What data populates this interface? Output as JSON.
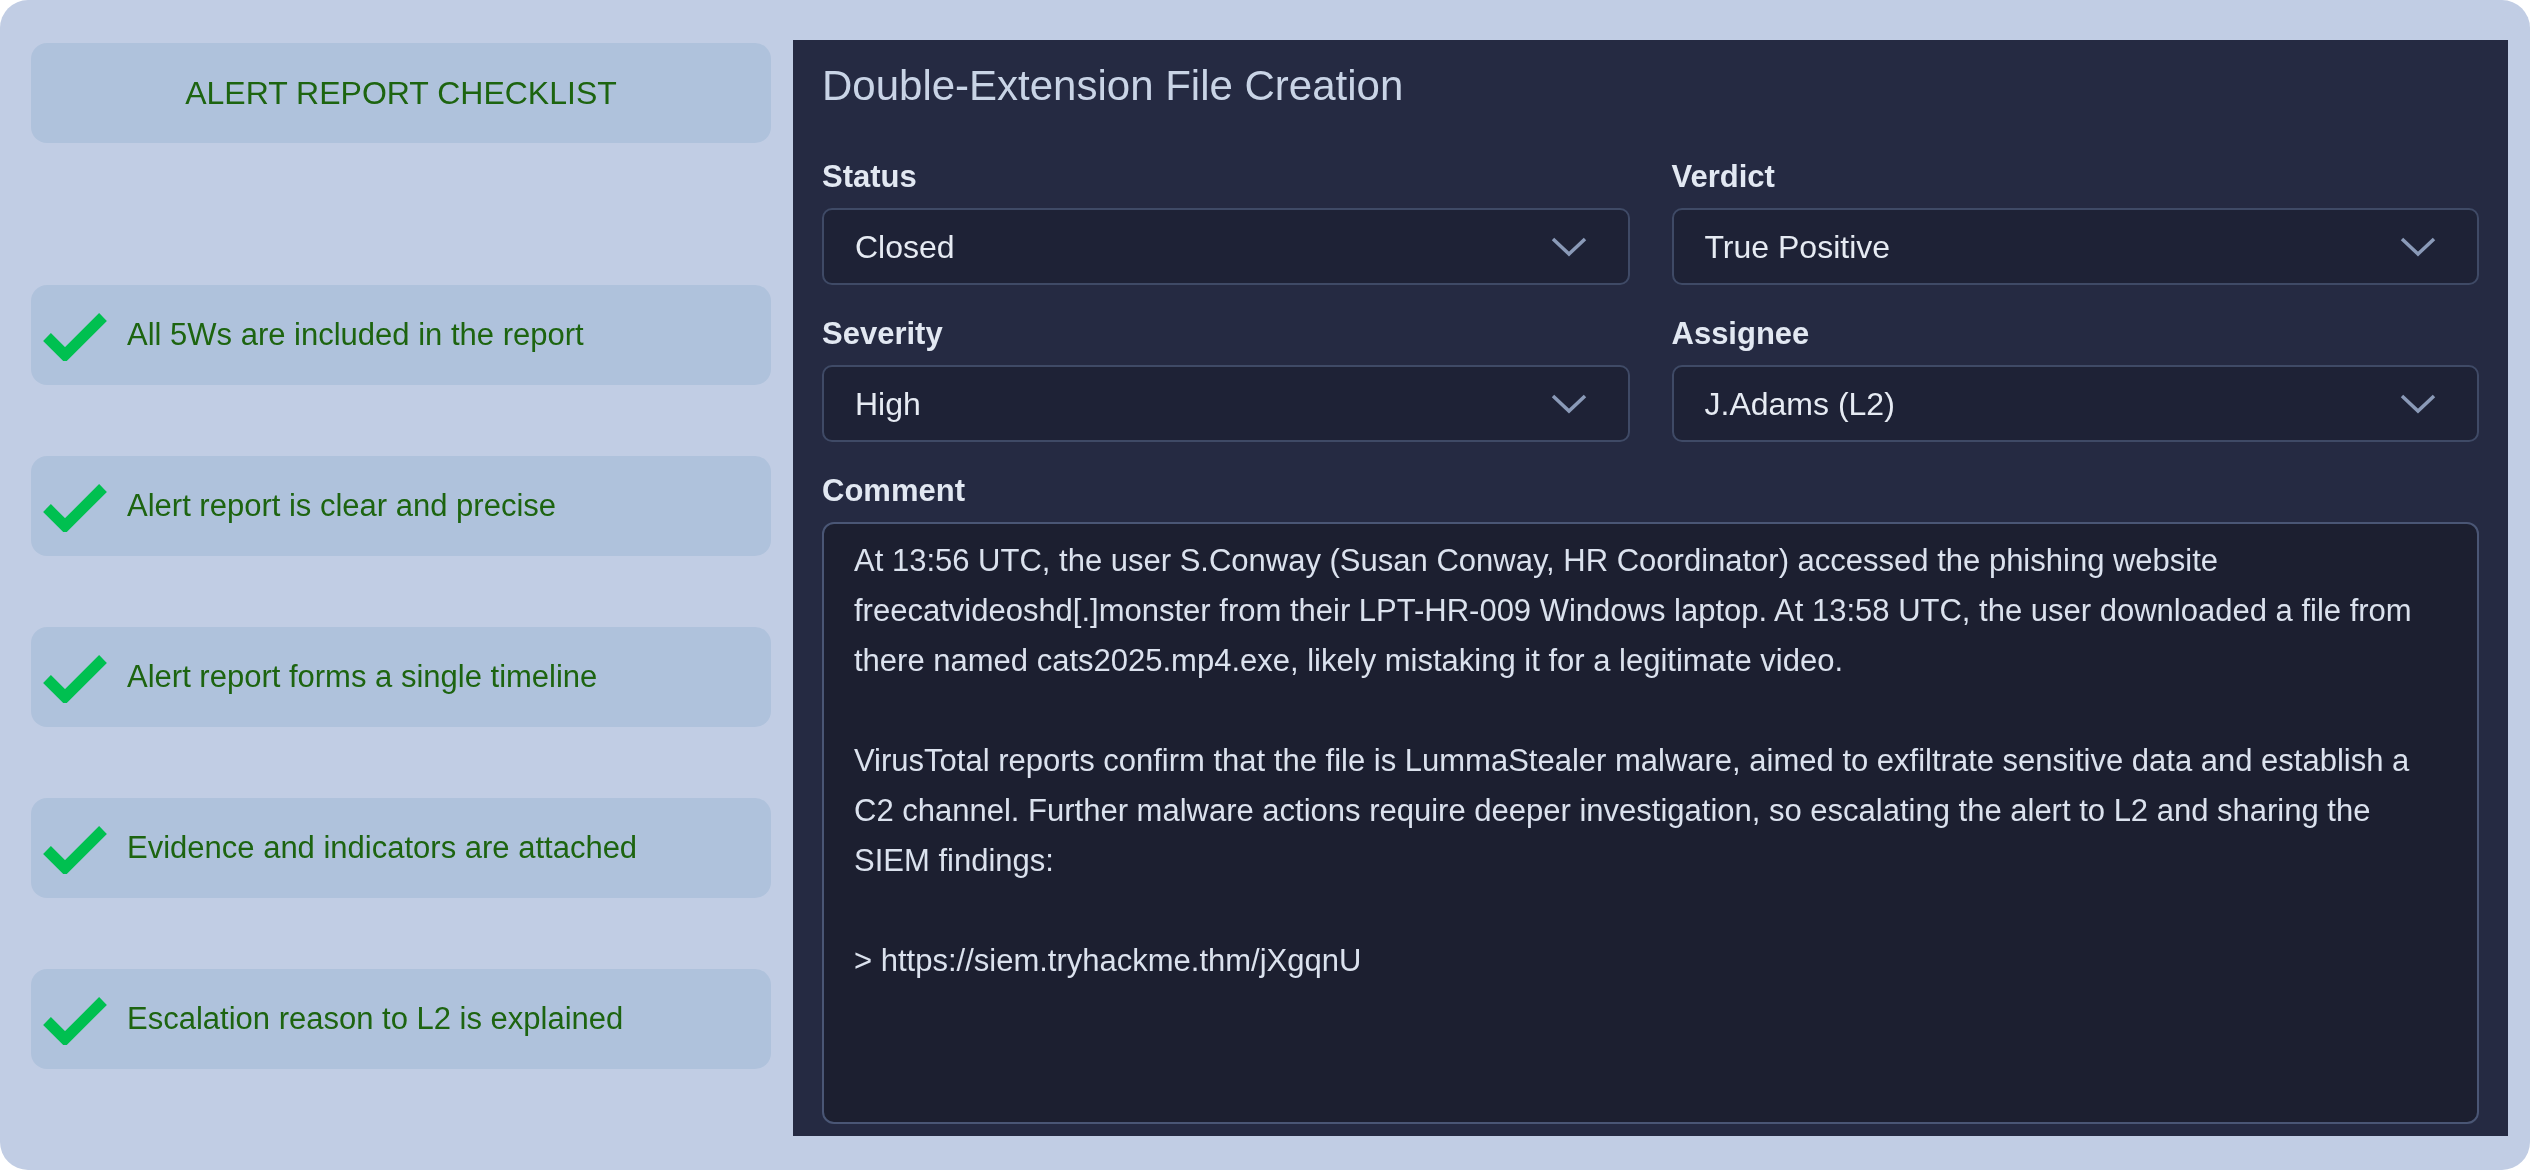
{
  "checklist": {
    "title": "ALERT REPORT CHECKLIST",
    "items": [
      {
        "label": "All 5Ws are included in the report",
        "checked": true
      },
      {
        "label": "Alert report is clear and precise",
        "checked": true
      },
      {
        "label": "Alert report forms a single timeline",
        "checked": true
      },
      {
        "label": "Evidence and indicators are attached",
        "checked": true
      },
      {
        "label": "Escalation reason to L2 is explained",
        "checked": true
      }
    ]
  },
  "alert": {
    "title": "Double-Extension File Creation",
    "fields": [
      {
        "label": "Status",
        "value": "Closed"
      },
      {
        "label": "Verdict",
        "value": "True Positive"
      },
      {
        "label": "Severity",
        "value": "High"
      },
      {
        "label": "Assignee",
        "value": "J.Adams (L2)"
      }
    ],
    "comment": {
      "label": "Comment",
      "value": "At 13:56 UTC, the user S.Conway (Susan Conway, HR Coordinator) accessed the phishing website freecatvideoshd[.]monster from their LPT-HR-009 Windows laptop. At 13:58 UTC, the user downloaded a file from there named cats2025.mp4.exe, likely mistaking it for a legitimate video.\n\nVirusTotal reports confirm that the file is LummaStealer malware, aimed to exfiltrate sensitive data and establish a C2 channel. Further malware actions require deeper investigation, so escalating the alert to L2 and sharing the SIEM findings:\n\n> https://siem.tryhackme.thm/jXgqnU"
    }
  }
}
